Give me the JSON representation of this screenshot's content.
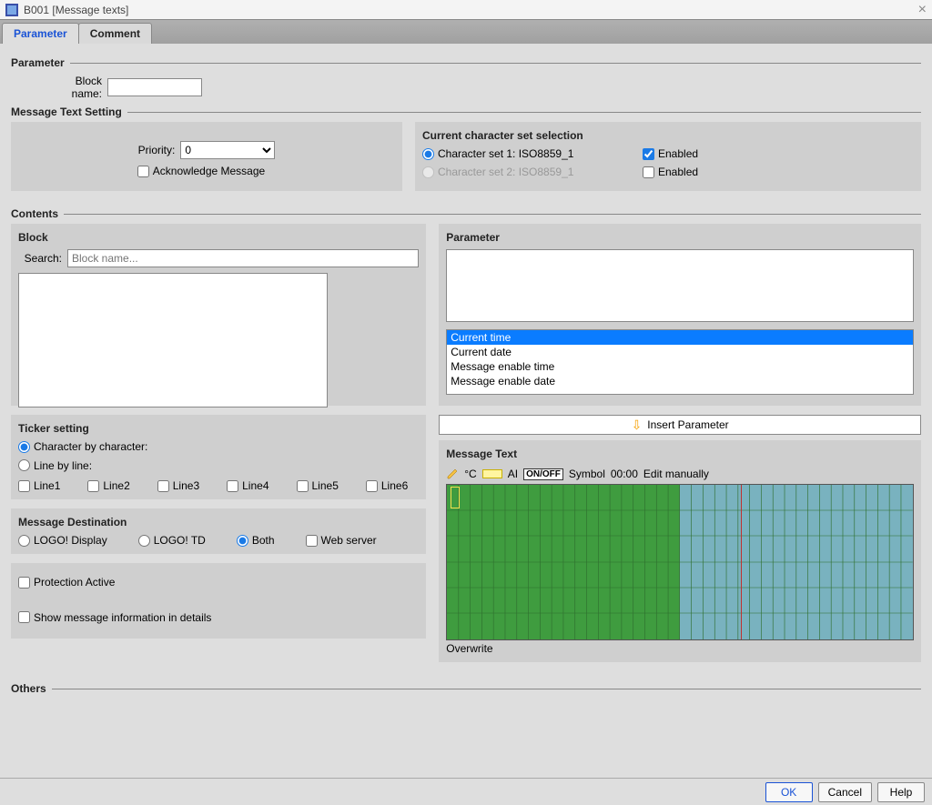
{
  "window": {
    "title": "B001 [Message texts]"
  },
  "tabs": {
    "parameter": "Parameter",
    "comment": "Comment",
    "active": "parameter"
  },
  "section_parameter": {
    "title": "Parameter",
    "block_name_label": "Block name:",
    "block_name_value": ""
  },
  "section_mts": {
    "title": "Message Text Setting",
    "priority_label": "Priority:",
    "priority_value": "0",
    "ack_label": "Acknowledge Message",
    "ack_checked": false,
    "ccs_title": "Current character set selection",
    "cs1_label": "Character set 1: ISO8859_1",
    "cs2_label": "Character set 2: ISO8859_1",
    "enabled_label": "Enabled",
    "cs_selected": 1,
    "cs1_enabled": true,
    "cs2_enabled": false
  },
  "section_contents": {
    "title": "Contents",
    "block_title": "Block",
    "search_label": "Search:",
    "search_placeholder": "Block name...",
    "ticker_title": "Ticker setting",
    "ticker_char": "Character by character:",
    "ticker_line": "Line by line:",
    "ticker_selected": "char",
    "lines": [
      "Line1",
      "Line2",
      "Line3",
      "Line4",
      "Line5",
      "Line6"
    ],
    "dest_title": "Message Destination",
    "dest_logo": "LOGO! Display",
    "dest_td": "LOGO! TD",
    "dest_both": "Both",
    "dest_web": "Web server",
    "dest_selected": "both",
    "protection_label": "Protection Active",
    "protection_checked": false,
    "showinfo_label": "Show message information in details",
    "showinfo_checked": false,
    "param_title": "Parameter",
    "param_items": [
      "Current time",
      "Current date",
      "Message enable time",
      "Message enable date"
    ],
    "param_selected_index": 0,
    "insert_label": "Insert Parameter",
    "msgtext_title": "Message Text",
    "tool_degC": "°C",
    "tool_ai": "AI",
    "tool_onoff": "ON/OFF",
    "tool_symbol": "Symbol",
    "tool_time": "00:00",
    "tool_edit": "Edit manually",
    "overwrite": "Overwrite"
  },
  "section_others": {
    "title": "Others"
  },
  "footer": {
    "ok": "OK",
    "cancel": "Cancel",
    "help": "Help"
  }
}
